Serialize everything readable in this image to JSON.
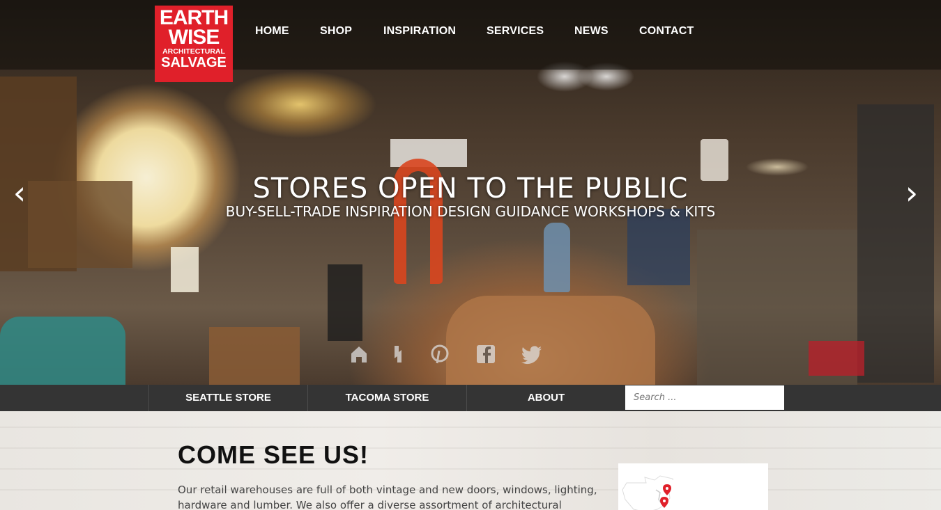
{
  "logo": {
    "line1": "EARTH",
    "line2": "WISE",
    "line3": "ARCHITECTURAL",
    "line4": "SALVAGE"
  },
  "nav": {
    "home": "HOME",
    "shop": "SHOP",
    "inspiration": "INSPIRATION",
    "services": "SERVICES",
    "news": "NEWS",
    "contact": "CONTACT"
  },
  "hero": {
    "title": "STORES OPEN TO THE PUBLIC",
    "subtitle": "BUY-SELL-TRADE  INSPIRATION  DESIGN  GUIDANCE  WORKSHOPS & KITS",
    "prev": "‹",
    "next": "›"
  },
  "social_icons": [
    "houzz-icon",
    "bookmark-icon",
    "pinterest-icon",
    "facebook-icon",
    "twitter-icon"
  ],
  "subnav": {
    "seattle": "SEATTLE STORE",
    "tacoma": "TACOMA STORE",
    "about": "ABOUT",
    "search_placeholder": "Search ..."
  },
  "content": {
    "heading": "COME SEE US!",
    "body": "Our retail warehouses are full of both vintage and new doors, windows, lighting, hardware and lumber. We also offer a diverse assortment of architectural antiques including stained"
  },
  "colors": {
    "brand_red": "#e0202a",
    "subnav_bg": "#343434",
    "map_pin": "#e0202a"
  }
}
